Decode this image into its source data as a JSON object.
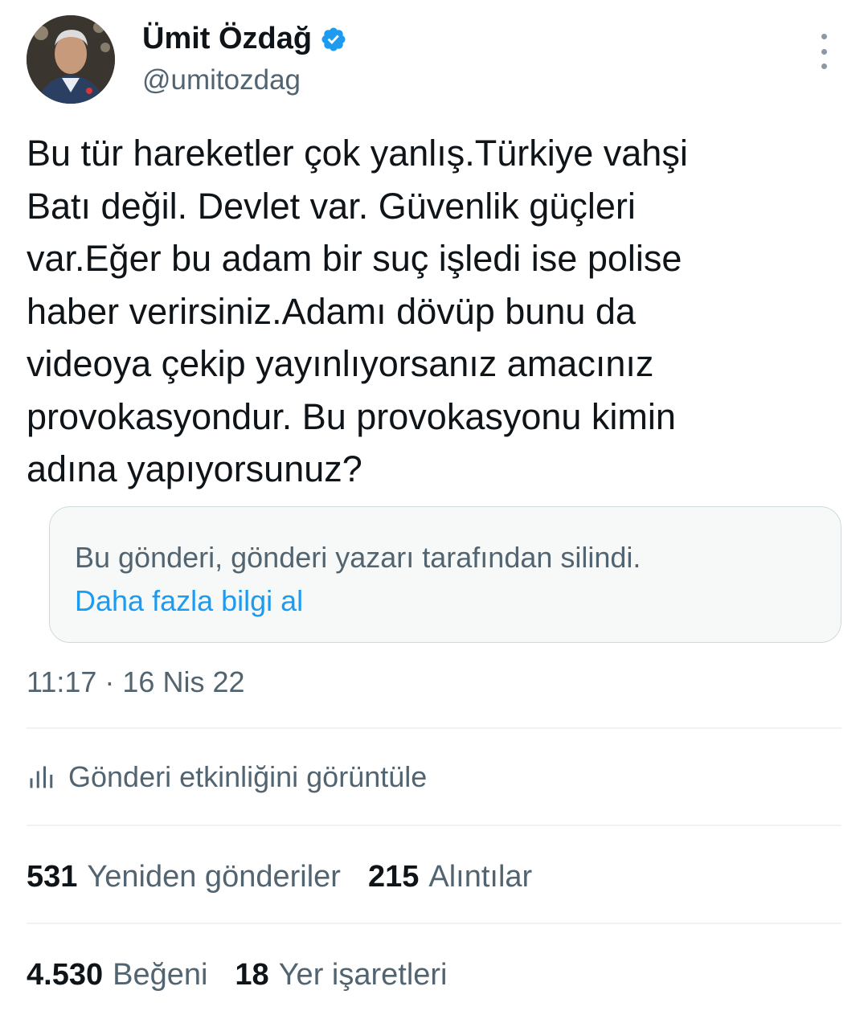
{
  "author": {
    "name": "Ümit Özdağ",
    "handle": "@umitozdag",
    "verified": true,
    "verified_color": "#1d9bf0"
  },
  "icons": {
    "verified": "verified-badge-icon",
    "more": "more-options-icon",
    "activity": "bar-chart-icon"
  },
  "tweet": {
    "lines": [
      "Bu tür hareketler çok yanlış.Türkiye vahşi",
      "Batı değil. Devlet var. Güvenlik güçleri",
      "var.Eğer bu adam bir suç işledi ise polise",
      "haber verirsiniz.Adamı dövüp bunu da",
      "videoya çekip yayınlıyorsanız amacınız",
      "provokasyondur. Bu provokasyonu kimin",
      "adına yapıyorsunuz?"
    ]
  },
  "quoted": {
    "message": "Bu gönderi, gönderi yazarı tarafından silindi.",
    "link": "Daha fazla bilgi al",
    "link_color": "#1d9bf0"
  },
  "timestamp": "11:17 · 16 Nis 22",
  "activity_label": "Gönderi etkinliğini görüntüle",
  "stats": {
    "reposts": {
      "value": "531",
      "label": "Yeniden gönderiler"
    },
    "quotes": {
      "value": "215",
      "label": "Alıntılar"
    },
    "likes": {
      "value": "4.530",
      "label": "Beğeni"
    },
    "bookmarks": {
      "value": "18",
      "label": "Yer işaretleri"
    }
  }
}
